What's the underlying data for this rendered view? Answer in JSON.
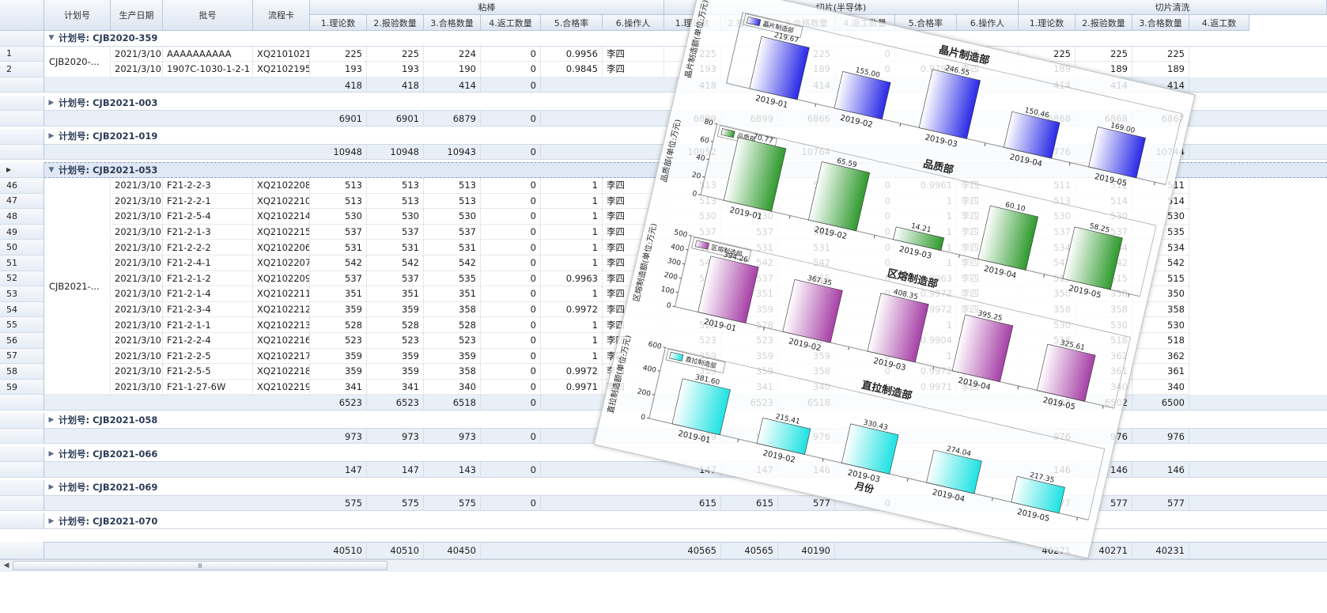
{
  "columns": {
    "plan_no": "计划号",
    "prod_date": "生产日期",
    "batch_no": "批号",
    "flow_card": "流程卡",
    "bands": [
      {
        "label": "粘棒",
        "subs": [
          "1.理论数",
          "2.报验数量",
          "3.合格数量",
          "4.返工数量",
          "5.合格率",
          "6.操作人"
        ]
      },
      {
        "label": "切片(半导体)",
        "subs": [
          "1.理论数",
          "2.报验数量",
          "3.合格数量",
          "4.返工数量",
          "5.合格率",
          "6.操作人"
        ]
      },
      {
        "label": "切片清洗",
        "subs": [
          "1.理论数",
          "2.报验数量",
          "3.合格数量",
          "4.返工数"
        ]
      }
    ]
  },
  "groups": [
    {
      "label": "计划号: CJB2020-359",
      "expanded": true,
      "plan_cell": "CJB2020-...",
      "rows": [
        {
          "idx": "1",
          "date": "2021/3/10",
          "batch": "AAAAAAAAAA",
          "card": "XQ2101021",
          "c1": [
            "225",
            "225",
            "224",
            "0",
            "0.9956",
            "李四"
          ],
          "c2": [
            "225",
            "225",
            "225",
            "0",
            "1",
            "李四"
          ],
          "c3": [
            "225",
            "225",
            "225"
          ]
        },
        {
          "idx": "2",
          "date": "2021/3/10",
          "batch": "1907C-1030-1-2-1",
          "card": "XQ2102195",
          "c1": [
            "193",
            "193",
            "190",
            "0",
            "0.9845",
            "李四"
          ],
          "c2": [
            "193",
            "189",
            "189",
            "0",
            "0.9793",
            "李四"
          ],
          "c3": [
            "189",
            "189",
            "189"
          ]
        }
      ],
      "totals": {
        "c1": [
          "418",
          "418",
          "414",
          "0"
        ],
        "c2": [
          "418",
          "414",
          "414"
        ],
        "c3": [
          "414",
          "414",
          "414"
        ]
      }
    },
    {
      "label": "计划号: CJB2021-003",
      "expanded": false,
      "rows": [],
      "totals": {
        "c1": [
          "6901",
          "6901",
          "6879",
          "0"
        ],
        "c2": [
          "6899",
          "6899",
          "6866"
        ],
        "c3": [
          "6868",
          "6868",
          "6867"
        ]
      }
    },
    {
      "label": "计划号: CJB2021-019",
      "expanded": false,
      "rows": [],
      "totals": {
        "c1": [
          "10948",
          "10948",
          "10943",
          "0"
        ],
        "c2": [
          "10952",
          "10952",
          "10764"
        ],
        "c3": [
          "10776",
          "10776",
          "10744"
        ]
      }
    },
    {
      "label": "计划号: CJB2021-053",
      "expanded": true,
      "selected": true,
      "plan_cell": "CJB2021-...",
      "rows": [
        {
          "idx": "46",
          "date": "2021/3/10",
          "batch": "F21-2-2-3",
          "card": "XQ2102208",
          "c1": [
            "513",
            "513",
            "513",
            "0",
            "1",
            "李四"
          ],
          "c2": [
            "513",
            "513",
            "511",
            "0",
            "0.9961",
            "李四"
          ],
          "c3": [
            "511",
            "511",
            "511"
          ]
        },
        {
          "idx": "47",
          "date": "2021/3/10",
          "batch": "F21-2-2-1",
          "card": "XQ2102210",
          "c1": [
            "513",
            "513",
            "513",
            "0",
            "1",
            "李四"
          ],
          "c2": [
            "513",
            "513",
            "513",
            "0",
            "1",
            "李四"
          ],
          "c3": [
            "513",
            "514",
            "514"
          ]
        },
        {
          "idx": "48",
          "date": "2021/3/10",
          "batch": "F21-2-5-4",
          "card": "XQ2102214",
          "c1": [
            "530",
            "530",
            "530",
            "0",
            "1",
            "李四"
          ],
          "c2": [
            "530",
            "530",
            "530",
            "0",
            "1",
            "李四"
          ],
          "c3": [
            "530",
            "530",
            "530"
          ]
        },
        {
          "idx": "49",
          "date": "2021/3/10",
          "batch": "F21-2-1-3",
          "card": "XQ2102215",
          "c1": [
            "537",
            "537",
            "537",
            "0",
            "1",
            "李四"
          ],
          "c2": [
            "537",
            "537",
            "535",
            "0",
            "1",
            "李四"
          ],
          "c3": [
            "537",
            "537",
            "535"
          ]
        },
        {
          "idx": "50",
          "date": "2021/3/10",
          "batch": "F21-2-2-2",
          "card": "XQ2102206",
          "c1": [
            "531",
            "531",
            "531",
            "0",
            "1",
            "李四"
          ],
          "c2": [
            "531",
            "531",
            "531",
            "0",
            "1",
            "李四"
          ],
          "c3": [
            "534",
            "534",
            "534"
          ]
        },
        {
          "idx": "51",
          "date": "2021/3/10",
          "batch": "F21-2-4-1",
          "card": "XQ2102207",
          "c1": [
            "542",
            "542",
            "542",
            "0",
            "1",
            "李四"
          ],
          "c2": [
            "542",
            "542",
            "542",
            "0",
            "1",
            "李四"
          ],
          "c3": [
            "542",
            "542",
            "542"
          ]
        },
        {
          "idx": "52",
          "date": "2021/3/10",
          "batch": "F21-2-1-2",
          "card": "XQ2102209",
          "c1": [
            "537",
            "537",
            "535",
            "0",
            "0.9963",
            "李四"
          ],
          "c2": [
            "537",
            "537",
            "515",
            "0",
            "0.9963",
            "李四"
          ],
          "c3": [
            "515",
            "515",
            "515"
          ]
        },
        {
          "idx": "53",
          "date": "2021/3/10",
          "batch": "F21-2-1-4",
          "card": "XQ2102211",
          "c1": [
            "351",
            "351",
            "351",
            "0",
            "1",
            "李四"
          ],
          "c2": [
            "351",
            "351",
            "350",
            "0",
            "0.9972",
            "李四"
          ],
          "c3": [
            "350",
            "350",
            "350"
          ]
        },
        {
          "idx": "54",
          "date": "2021/3/10",
          "batch": "F21-2-3-4",
          "card": "XQ2102212",
          "c1": [
            "359",
            "359",
            "358",
            "0",
            "0.9972",
            "李四"
          ],
          "c2": [
            "359",
            "359",
            "358",
            "0",
            "0.9972",
            "李四"
          ],
          "c3": [
            "358",
            "358",
            "358"
          ]
        },
        {
          "idx": "55",
          "date": "2021/3/10",
          "batch": "F21-2-1-1",
          "card": "XQ2102213",
          "c1": [
            "528",
            "528",
            "528",
            "0",
            "1",
            "李四"
          ],
          "c2": [
            "528",
            "528",
            "528",
            "0",
            "1",
            "李四"
          ],
          "c3": [
            "530",
            "530",
            "530"
          ]
        },
        {
          "idx": "56",
          "date": "2021/3/10",
          "batch": "F21-2-2-4",
          "card": "XQ2102216",
          "c1": [
            "523",
            "523",
            "523",
            "0",
            "1",
            "李四"
          ],
          "c2": [
            "523",
            "523",
            "523",
            "0",
            "0.9904",
            "李四"
          ],
          "c3": [
            "518",
            "518",
            "518"
          ]
        },
        {
          "idx": "57",
          "date": "2021/3/10",
          "batch": "F21-2-2-5",
          "card": "XQ2102217",
          "c1": [
            "359",
            "359",
            "359",
            "0",
            "1",
            "李四"
          ],
          "c2": [
            "359",
            "359",
            "359",
            "0",
            "1",
            "李四"
          ],
          "c3": [
            "362",
            "362",
            "362"
          ]
        },
        {
          "idx": "58",
          "date": "2021/3/10",
          "batch": "F21-2-5-5",
          "card": "XQ2102218",
          "c1": [
            "359",
            "359",
            "358",
            "0",
            "0.9972",
            "李四"
          ],
          "c2": [
            "359",
            "359",
            "358",
            "0",
            "0.9972",
            "李四"
          ],
          "c3": [
            "361",
            "361",
            "361"
          ]
        },
        {
          "idx": "59",
          "date": "2021/3/10",
          "batch": "F21-1-27-6W",
          "card": "XQ2102219",
          "c1": [
            "341",
            "341",
            "340",
            "0",
            "0.9971",
            "李四"
          ],
          "c2": [
            "341",
            "341",
            "340",
            "0",
            "0.9971",
            "李四"
          ],
          "c3": [
            "340",
            "340",
            "340"
          ]
        }
      ],
      "totals": {
        "c1": [
          "6523",
          "6523",
          "6518",
          "0"
        ],
        "c2": [
          "6523",
          "6523",
          "6518"
        ],
        "c3": [
          "6502",
          "6502",
          "6500"
        ]
      }
    },
    {
      "label": "计划号: CJB2021-058",
      "expanded": false,
      "rows": [],
      "totals": {
        "c1": [
          "973",
          "973",
          "973",
          "0"
        ],
        "c2": [
          "979",
          "979",
          "976"
        ],
        "c3": [
          "976",
          "976",
          "976"
        ]
      }
    },
    {
      "label": "计划号: CJB2021-066",
      "expanded": false,
      "rows": [],
      "totals": {
        "c1": [
          "147",
          "147",
          "143",
          "0"
        ],
        "c2": [
          "147",
          "147",
          "146"
        ],
        "c3": [
          "146",
          "146",
          "146"
        ]
      }
    },
    {
      "label": "计划号: CJB2021-069",
      "expanded": false,
      "rows": [],
      "totals": {
        "c1": [
          "575",
          "575",
          "575",
          "0"
        ],
        "c2": [
          "615",
          "615",
          "577",
          "0"
        ],
        "c3": [
          "577",
          "577",
          "577"
        ]
      }
    },
    {
      "label": "计划号: CJB2021-070",
      "expanded": false,
      "rows": [],
      "totals": null
    }
  ],
  "grand_total": {
    "c1": [
      "40510",
      "40510",
      "40450"
    ],
    "c2": [
      "40565",
      "40565",
      "40190"
    ],
    "c3": [
      "40271",
      "40271",
      "40231"
    ]
  },
  "scrollbar": {
    "grip": "Ⅲ"
  },
  "colors": {
    "header_bg": "#dde6f2",
    "group_selected": "#dfe8f4",
    "footer_bg": "#e9eff7",
    "blue": "#2a2ae8",
    "green": "#2e9a2e",
    "purple": "#a640a6",
    "cyan": "#1fe2e2"
  },
  "chart_data": [
    {
      "type": "bar",
      "title": "晶片制造部",
      "ylabel": "晶片制造额(单位:万元)",
      "xlabel": "",
      "legend": "晶片制造部",
      "categories": [
        "2019-01",
        "2019-02",
        "2019-03",
        "2019-04",
        "2019-05"
      ],
      "values": [
        219.67,
        155.0,
        246.55,
        150.46,
        169.0
      ],
      "value_labels": [
        "219.67",
        "155.00",
        "246.55",
        "150.46",
        "169.00"
      ],
      "ylim": [
        0,
        300
      ],
      "color": "#2a2ae8"
    },
    {
      "type": "bar",
      "title": "品质部",
      "ylabel": "品质部(单位:万元)",
      "xlabel": "",
      "legend": "品质部",
      "categories": [
        "2019-01",
        "2019-02",
        "2019-03",
        "2019-04",
        "2019-05"
      ],
      "values": [
        70.77,
        65.59,
        14.21,
        60.1,
        58.25
      ],
      "value_labels": [
        "70.77",
        "65.59",
        "14.21",
        "60.10",
        "58.25"
      ],
      "yticks": [
        "0",
        "20",
        "40",
        "60",
        "80"
      ],
      "ylim": [
        0,
        80
      ],
      "color": "#2e9a2e"
    },
    {
      "type": "bar",
      "title": "区熔制造部",
      "ylabel": "区熔制造额(单位:万元)",
      "xlabel": "",
      "legend": "区熔制造部",
      "categories": [
        "2019-01",
        "2019-02",
        "2019-03",
        "2019-04",
        "2019-05"
      ],
      "values": [
        394.26,
        367.35,
        408.35,
        395.25,
        325.61
      ],
      "value_labels": [
        "394.26",
        "367.35",
        "408.35",
        "395.25",
        "325.61"
      ],
      "yticks": [
        "0",
        "100",
        "200",
        "300",
        "400",
        "500"
      ],
      "ylim": [
        0,
        500
      ],
      "color": "#a640a6"
    },
    {
      "type": "bar",
      "title": "直拉制造部",
      "ylabel": "直拉制造额(单位:万元)",
      "xlabel": "月份",
      "legend": "直拉制造部",
      "categories": [
        "2019-01",
        "2019-02",
        "2019-03",
        "2019-04",
        "2019-05"
      ],
      "values": [
        381.6,
        215.41,
        330.43,
        274.04,
        217.35
      ],
      "value_labels": [
        "381.60",
        "215.41",
        "330.43",
        "274.04",
        "217.35"
      ],
      "yticks": [
        "0",
        "200",
        "400",
        "600"
      ],
      "ylim": [
        0,
        600
      ],
      "color": "#1fe2e2"
    }
  ]
}
